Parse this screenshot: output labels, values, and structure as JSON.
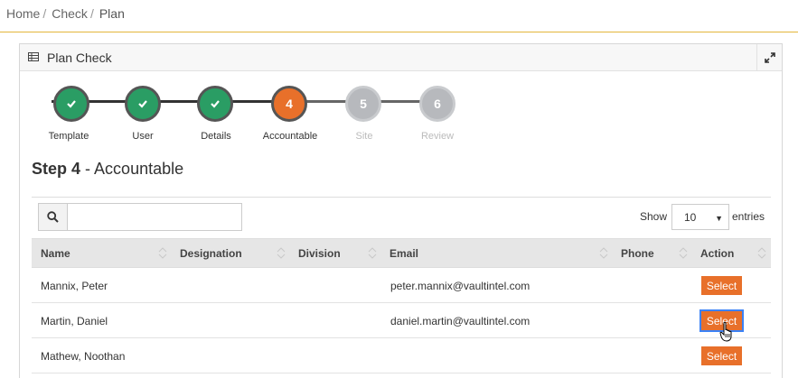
{
  "breadcrumb": {
    "items": [
      "Home",
      "Check",
      "Plan"
    ],
    "separator": "/"
  },
  "panel": {
    "title": "Plan Check",
    "title_icon": "table-icon",
    "expand_icon": "expand-icon"
  },
  "stepper": {
    "steps": [
      {
        "number": "1",
        "label": "Template",
        "state": "done"
      },
      {
        "number": "2",
        "label": "User",
        "state": "done"
      },
      {
        "number": "3",
        "label": "Details",
        "state": "done"
      },
      {
        "number": "4",
        "label": "Accountable",
        "state": "current"
      },
      {
        "number": "5",
        "label": "Site",
        "state": "todo"
      },
      {
        "number": "6",
        "label": "Review",
        "state": "todo"
      }
    ]
  },
  "heading": {
    "step": "Step 4",
    "dash": " - ",
    "title": "Accountable"
  },
  "search": {
    "value": "",
    "placeholder": ""
  },
  "entries": {
    "show_label": "Show",
    "selected": "10",
    "suffix_label": "entries"
  },
  "table": {
    "columns": [
      "Name",
      "Designation",
      "Division",
      "Email",
      "Phone",
      "Action"
    ],
    "rows": [
      {
        "name": "Mannix, Peter",
        "designation": "",
        "division": "",
        "email": "peter.mannix@vaultintel.com",
        "phone": "",
        "action": "Select"
      },
      {
        "name": "Martin, Daniel",
        "designation": "",
        "division": "",
        "email": "daniel.martin@vaultintel.com",
        "phone": "",
        "action": "Select"
      },
      {
        "name": "Mathew, Noothan",
        "designation": "",
        "division": "",
        "email": "",
        "phone": "",
        "action": "Select"
      }
    ]
  },
  "colors": {
    "accent_orange": "#e8702a",
    "done_green": "#2a9d64",
    "todo_grey": "#b7b9bd",
    "header_rule": "#e4b63a"
  }
}
